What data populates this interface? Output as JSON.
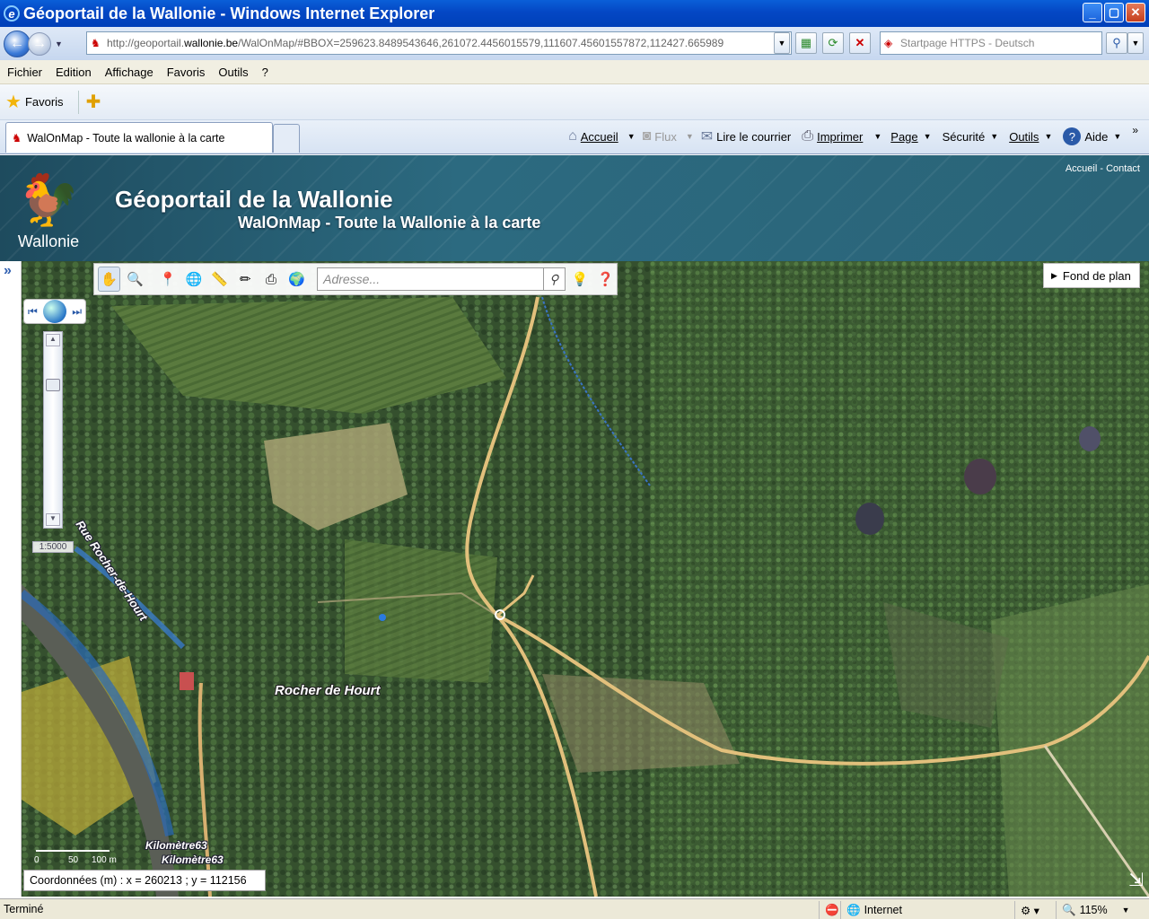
{
  "window": {
    "title": "Géoportail de la Wallonie - Windows Internet Explorer"
  },
  "address_bar": {
    "url_prefix": "http://geoportail.",
    "url_domain": "wallonie.be",
    "url_rest": "/WalOnMap/#BBOX=259623.8489543646,261072.4456015579,111607.45601557872,112427.665989",
    "search_placeholder": "Startpage HTTPS - Deutsch"
  },
  "menu": {
    "items": [
      "Fichier",
      "Edition",
      "Affichage",
      "Favoris",
      "Outils",
      "?"
    ]
  },
  "favorites_bar": {
    "favoris_label": "Favoris"
  },
  "tabs": {
    "active_label": "WalOnMap - Toute la wallonie à la carte"
  },
  "command_bar": {
    "accueil": "Accueil",
    "flux": "Flux",
    "lire_courrier": "Lire le courrier",
    "imprimer": "Imprimer",
    "page": "Page",
    "securite": "Sécurité",
    "outils": "Outils",
    "aide": "Aide"
  },
  "header": {
    "logo_text": "Wallonie",
    "title": "Géoportail de la Wallonie",
    "subtitle": "WalOnMap - Toute la Wallonie à la carte",
    "link_accueil": "Accueil",
    "link_sep": " - ",
    "link_contact": "Contact"
  },
  "map": {
    "address_placeholder": "Adresse...",
    "fond_de_plan": "Fond de plan",
    "scale_denominator": "1:5000",
    "place_label": "Rocher de Hourt",
    "street_label": "Rue  Rocher-de-Hourt",
    "km_label_1": "Kilomètre63",
    "km_label_2": "Kilomètre63",
    "scalebar": {
      "zero": "0",
      "mid": "50",
      "end": "100 m"
    },
    "coords_text": "Coordonnées (m) : x = 260213 ; y = 112156",
    "zoom_level": 0.2
  },
  "status_bar": {
    "left": "Terminé",
    "zone": "Internet",
    "zoom": "115%"
  }
}
